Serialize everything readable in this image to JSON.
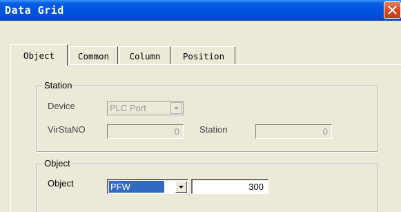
{
  "window": {
    "title": "Data Grid"
  },
  "tabs": [
    {
      "label": "Object"
    },
    {
      "label": "Common"
    },
    {
      "label": "Column"
    },
    {
      "label": "Position"
    }
  ],
  "station_group": {
    "title": "Station",
    "device_label": "Device",
    "device_value": "PLC Port",
    "virsta_label": "VirStaNO",
    "virsta_value": "0",
    "station_label": "Station",
    "station_value": "0"
  },
  "object_group": {
    "title": "Object",
    "object_label": "Object",
    "object_type": "PFW",
    "object_address": "300"
  },
  "colors": {
    "titlebar": "#0054e3",
    "dialog_bg": "#ece9d8",
    "selection": "#316ac5",
    "close": "#d8431e"
  },
  "icons": {
    "close": "close-icon",
    "dropdown": "chevron-down-icon"
  }
}
